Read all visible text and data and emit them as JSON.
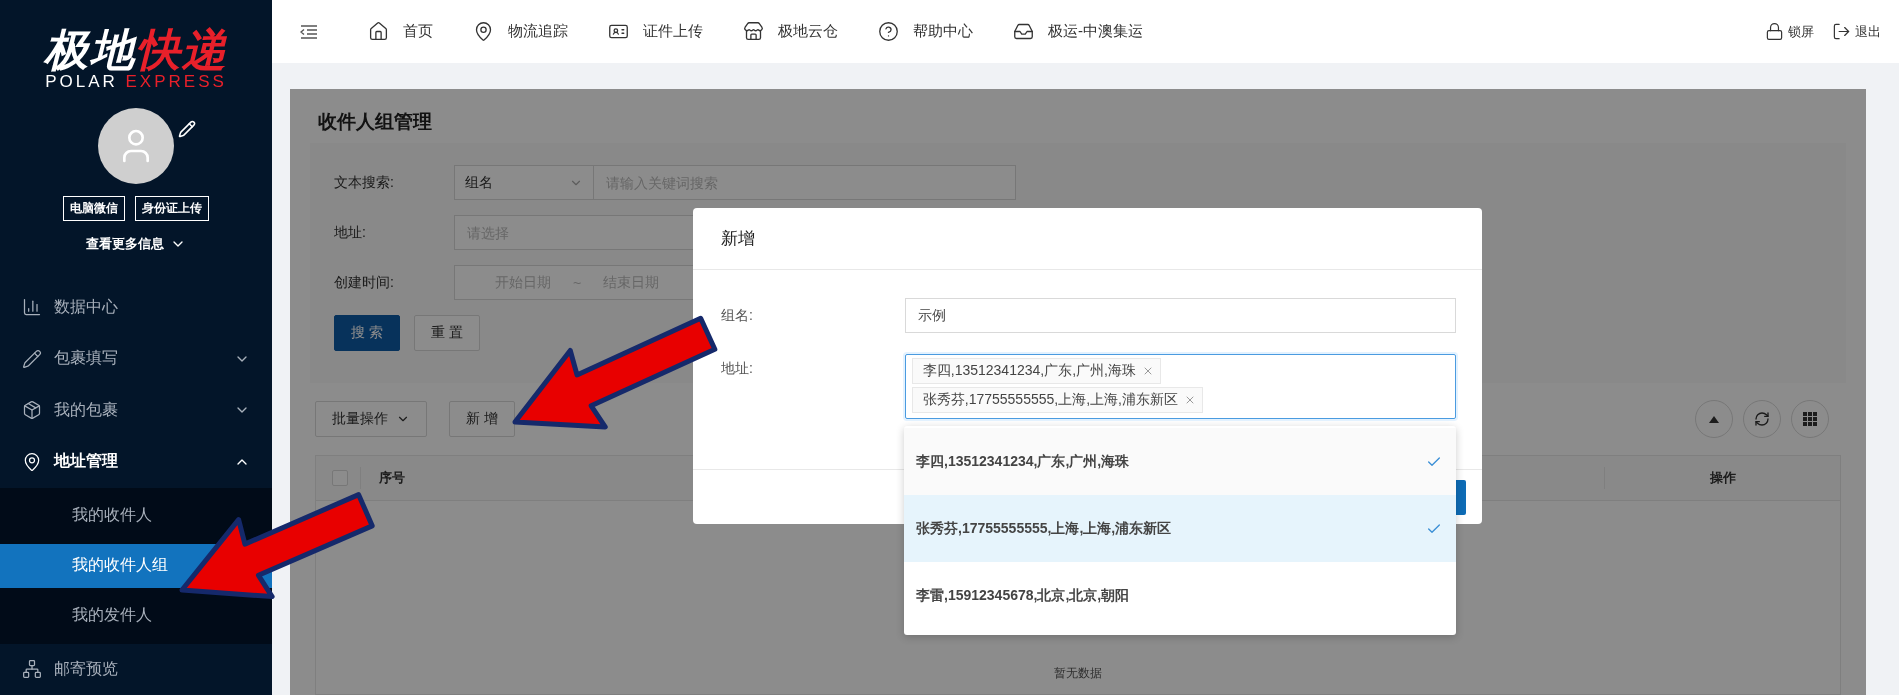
{
  "logo": {
    "main": "极地",
    "accent": "快递",
    "sub_main": "POLAR",
    "sub_accent": "EXPRESS"
  },
  "profile": {
    "buttons": [
      "电脑微信",
      "身份证上传"
    ],
    "more": "查看更多信息"
  },
  "sidebar": {
    "items": [
      {
        "label": "数据中心"
      },
      {
        "label": "包裹填写",
        "expanded": false
      },
      {
        "label": "我的包裹",
        "expanded": false
      },
      {
        "label": "地址管理",
        "expanded": true,
        "children": [
          {
            "label": "我的收件人",
            "selected": false
          },
          {
            "label": "我的收件人组",
            "selected": true
          },
          {
            "label": "我的发件人",
            "selected": false
          }
        ]
      },
      {
        "label": "邮寄预览"
      }
    ]
  },
  "topbar": {
    "nav": [
      "首页",
      "物流追踪",
      "证件上传",
      "极地云仓",
      "帮助中心",
      "极运-中澳集运"
    ],
    "actions": [
      "锁屏",
      "退出"
    ]
  },
  "page": {
    "title": "收件人组管理",
    "search": {
      "text_label": "文本搜索:",
      "text_type": "组名",
      "text_placeholder": "请输入关键词搜索",
      "address_label": "地址:",
      "address_placeholder": "请选择",
      "date_label": "创建时间:",
      "date_start": "开始日期",
      "date_sep": "~",
      "date_end": "结束日期",
      "buttons": [
        "搜 索",
        "重 置"
      ]
    },
    "toolbar": {
      "batch": "批量操作",
      "add": "新 增"
    },
    "table": {
      "select_all": {
        "checked": false
      },
      "columns": [
        "序号",
        "操作"
      ],
      "empty": "暂无数据"
    }
  },
  "modal": {
    "title": "新增",
    "name_label": "组名:",
    "name_value": "示例",
    "address_label": "地址:",
    "tags": [
      "李四,13512341234,广东,广州,海珠",
      "张秀芬,17755555555,上海,上海,浦东新区"
    ],
    "dropdown": [
      {
        "label": "李四,13512341234,广东,广州,海珠",
        "selected": true,
        "active": false
      },
      {
        "label": "张秀芬,17755555555,上海,上海,浦东新区",
        "selected": true,
        "active": true
      },
      {
        "label": "李雷,15912345678,北京,北京,朝阳",
        "selected": false,
        "active": false
      }
    ]
  }
}
